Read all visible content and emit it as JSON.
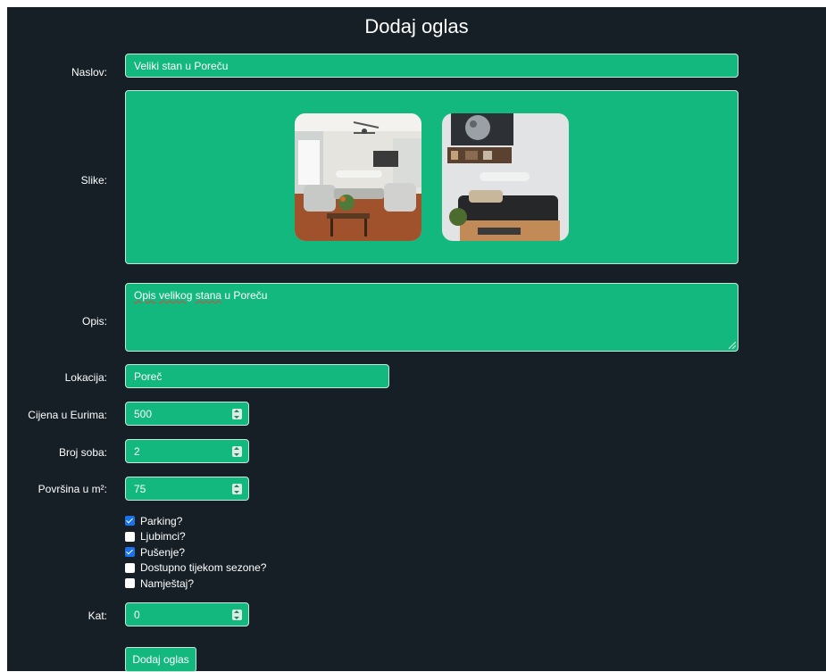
{
  "form": {
    "title": "Dodaj oglas",
    "naslov": {
      "label": "Naslov:",
      "value": "Veliki stan u Poreču"
    },
    "slike": {
      "label": "Slike:"
    },
    "opis": {
      "label": "Opis:",
      "word1": "Opis",
      "word2": "velikog",
      "word3": "stana",
      "rest": " u Poreču"
    },
    "lokacija": {
      "label": "Lokacija:",
      "value": "Poreč"
    },
    "cijena": {
      "label": "Cijena u Eurima:",
      "value": "500"
    },
    "broj_soba": {
      "label": "Broj soba:",
      "value": "2"
    },
    "povrsina": {
      "label": "Površina u m²:",
      "value": "75"
    },
    "checkboxes": [
      {
        "label": "Parking?",
        "checked": true
      },
      {
        "label": "Ljubimci?",
        "checked": false
      },
      {
        "label": "Pušenje?",
        "checked": true
      },
      {
        "label": "Dostupno tijekom sezone?",
        "checked": false
      },
      {
        "label": "Namještaj?",
        "checked": false
      }
    ],
    "kat": {
      "label": "Kat:",
      "value": "0"
    },
    "submit_label": "Dodaj oglas"
  },
  "colors": {
    "background": "#161f26",
    "accent": "#13b87f",
    "checkbox_checked": "#1a73e8"
  }
}
